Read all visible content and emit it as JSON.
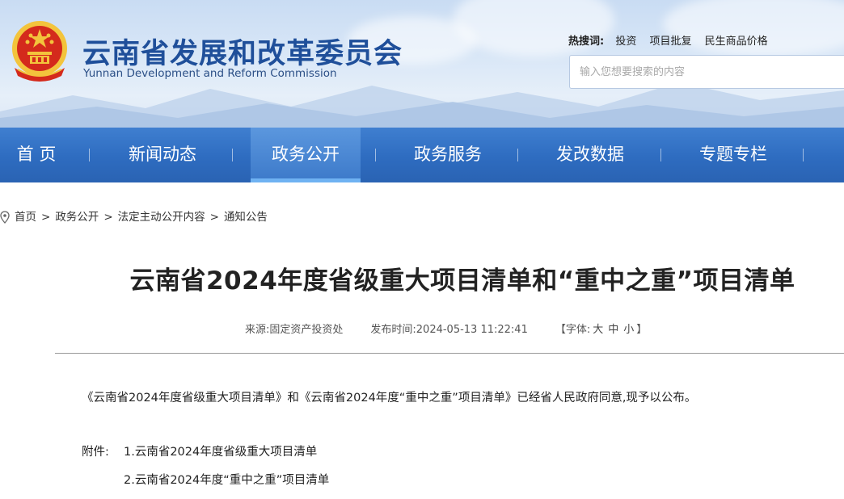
{
  "header": {
    "title_cn": "云南省发展和改革委员会",
    "title_en": "Yunnan Development and Reform Commission",
    "hotwords_label": "热搜词:",
    "hotwords": [
      "投资",
      "项目批复",
      "民生商品价格"
    ],
    "search_placeholder": "输入您想要搜索的内容"
  },
  "nav": {
    "items": [
      {
        "label": "首 页"
      },
      {
        "label": "新闻动态"
      },
      {
        "label": "政务公开",
        "active": true
      },
      {
        "label": "政务服务"
      },
      {
        "label": "发改数据"
      },
      {
        "label": "专题专栏"
      }
    ]
  },
  "breadcrumb": [
    "首页",
    "政务公开",
    "法定主动公开内容",
    "通知公告"
  ],
  "article": {
    "title": "云南省2024年度省级重大项目清单和“重中之重”项目清单",
    "source": "来源:固定资产投资处",
    "published": "发布时间:2024-05-13 11:22:41",
    "font_size_label_open": "【字体:",
    "font_large": "大",
    "font_medium": "中",
    "font_small": "小",
    "font_size_label_close": "】",
    "paragraph": "《云南省2024年度省级重大项目清单》和《云南省2024年度“重中之重”项目清单》已经省人民政府同意,现予以公布。",
    "attachments_label": "附件:",
    "attachments": [
      "1.云南省2024年度省级重大项目清单",
      "2.云南省2024年度“重中之重”项目清单"
    ]
  },
  "colors": {
    "nav_bg": "#2e6cc0",
    "nav_active": "#4a88d6",
    "title_blue": "#1f4f9a",
    "emblem_red": "#d42a1c",
    "emblem_gold": "#f3c43c"
  },
  "icons": [
    "national-emblem-icon",
    "location-pin-icon"
  ]
}
